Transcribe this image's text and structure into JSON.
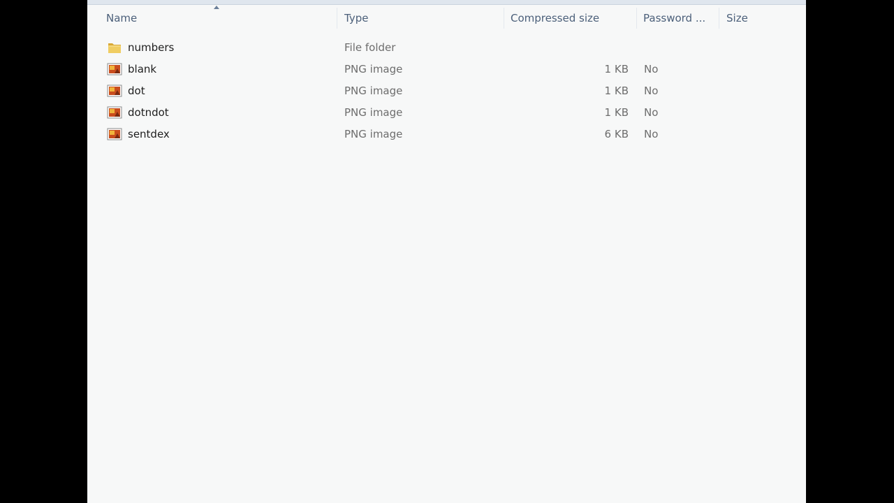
{
  "columns": {
    "name": "Name",
    "type": "Type",
    "compressed_size": "Compressed size",
    "password": "Password ...",
    "size": "Size"
  },
  "files": [
    {
      "name": "numbers",
      "type": "File folder",
      "compressed_size": "",
      "password": "",
      "icon": "folder-icon"
    },
    {
      "name": "blank",
      "type": "PNG image",
      "compressed_size": "1 KB",
      "password": "No",
      "icon": "png-image-icon"
    },
    {
      "name": "dot",
      "type": "PNG image",
      "compressed_size": "1 KB",
      "password": "No",
      "icon": "png-image-icon"
    },
    {
      "name": "dotndot",
      "type": "PNG image",
      "compressed_size": "1 KB",
      "password": "No",
      "icon": "png-image-icon"
    },
    {
      "name": "sentdex",
      "type": "PNG image",
      "compressed_size": "6 KB",
      "password": "No",
      "icon": "png-image-icon"
    }
  ],
  "colors": {
    "header_text": "#4c607a",
    "background": "#f7f8f8",
    "folder": "#e8c25a",
    "png_icon": "#c94d1e"
  }
}
